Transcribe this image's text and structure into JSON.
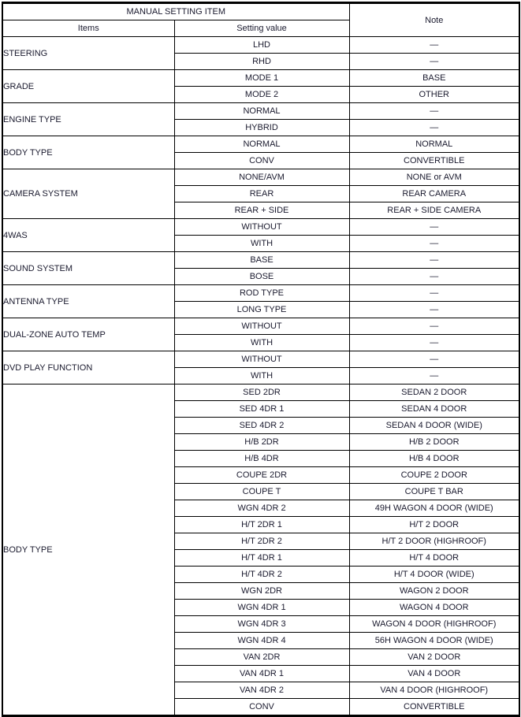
{
  "table": {
    "header": {
      "group_label": "MANUAL SETTING ITEM",
      "note_label": "Note",
      "col_items": "Items",
      "col_setting_value": "Setting value"
    },
    "dash": "—",
    "groups": [
      {
        "item": "STEERING",
        "rows": [
          {
            "value": "LHD",
            "note": "—"
          },
          {
            "value": "RHD",
            "note": "—"
          }
        ]
      },
      {
        "item": "GRADE",
        "rows": [
          {
            "value": "MODE 1",
            "note": "BASE"
          },
          {
            "value": "MODE 2",
            "note": "OTHER"
          }
        ]
      },
      {
        "item": "ENGINE TYPE",
        "rows": [
          {
            "value": "NORMAL",
            "note": "—"
          },
          {
            "value": "HYBRID",
            "note": "—"
          }
        ]
      },
      {
        "item": "BODY TYPE",
        "rows": [
          {
            "value": "NORMAL",
            "note": "NORMAL"
          },
          {
            "value": "CONV",
            "note": "CONVERTIBLE"
          }
        ]
      },
      {
        "item": "CAMERA SYSTEM",
        "rows": [
          {
            "value": "NONE/AVM",
            "note": "NONE or AVM"
          },
          {
            "value": "REAR",
            "note": "REAR CAMERA"
          },
          {
            "value": "REAR + SIDE",
            "note": "REAR + SIDE CAMERA"
          }
        ]
      },
      {
        "item": "4WAS",
        "rows": [
          {
            "value": "WITHOUT",
            "note": "—"
          },
          {
            "value": "WITH",
            "note": "—"
          }
        ]
      },
      {
        "item": "SOUND SYSTEM",
        "rows": [
          {
            "value": "BASE",
            "note": "—"
          },
          {
            "value": "BOSE",
            "note": "—"
          }
        ]
      },
      {
        "item": "ANTENNA TYPE",
        "rows": [
          {
            "value": "ROD TYPE",
            "note": "—"
          },
          {
            "value": "LONG TYPE",
            "note": "—"
          }
        ]
      },
      {
        "item": "DUAL-ZONE AUTO TEMP",
        "rows": [
          {
            "value": "WITHOUT",
            "note": "—"
          },
          {
            "value": "WITH",
            "note": "—"
          }
        ]
      },
      {
        "item": "DVD PLAY FUNCTION",
        "rows": [
          {
            "value": "WITHOUT",
            "note": "—"
          },
          {
            "value": "WITH",
            "note": "—"
          }
        ]
      },
      {
        "item": "BODY TYPE",
        "rows": [
          {
            "value": "SED 2DR",
            "note": "SEDAN 2 DOOR"
          },
          {
            "value": "SED 4DR 1",
            "note": "SEDAN 4 DOOR"
          },
          {
            "value": "SED 4DR 2",
            "note": "SEDAN 4 DOOR (WIDE)"
          },
          {
            "value": "H/B 2DR",
            "note": "H/B 2 DOOR"
          },
          {
            "value": "H/B 4DR",
            "note": "H/B 4 DOOR"
          },
          {
            "value": "COUPE 2DR",
            "note": "COUPE 2 DOOR"
          },
          {
            "value": "COUPE T",
            "note": "COUPE T BAR"
          },
          {
            "value": "WGN 4DR 2",
            "note": "49H WAGON 4 DOOR (WIDE)"
          },
          {
            "value": "H/T 2DR 1",
            "note": "H/T 2 DOOR"
          },
          {
            "value": "H/T 2DR 2",
            "note": "H/T 2 DOOR (HIGHROOF)"
          },
          {
            "value": "H/T 4DR 1",
            "note": "H/T 4 DOOR"
          },
          {
            "value": "H/T 4DR 2",
            "note": "H/T 4 DOOR (WIDE)"
          },
          {
            "value": "WGN 2DR",
            "note": "WAGON 2 DOOR"
          },
          {
            "value": "WGN 4DR 1",
            "note": "WAGON 4 DOOR"
          },
          {
            "value": "WGN 4DR 3",
            "note": "WAGON 4 DOOR (HIGHROOF)"
          },
          {
            "value": "WGN 4DR 4",
            "note": "56H WAGON 4 DOOR (WIDE)"
          },
          {
            "value": "VAN 2DR",
            "note": "VAN 2 DOOR"
          },
          {
            "value": "VAN 4DR 1",
            "note": "VAN 4 DOOR"
          },
          {
            "value": "VAN 4DR 2",
            "note": "VAN 4 DOOR (HIGHROOF)"
          },
          {
            "value": "CONV",
            "note": "CONVERTIBLE"
          }
        ]
      }
    ]
  }
}
